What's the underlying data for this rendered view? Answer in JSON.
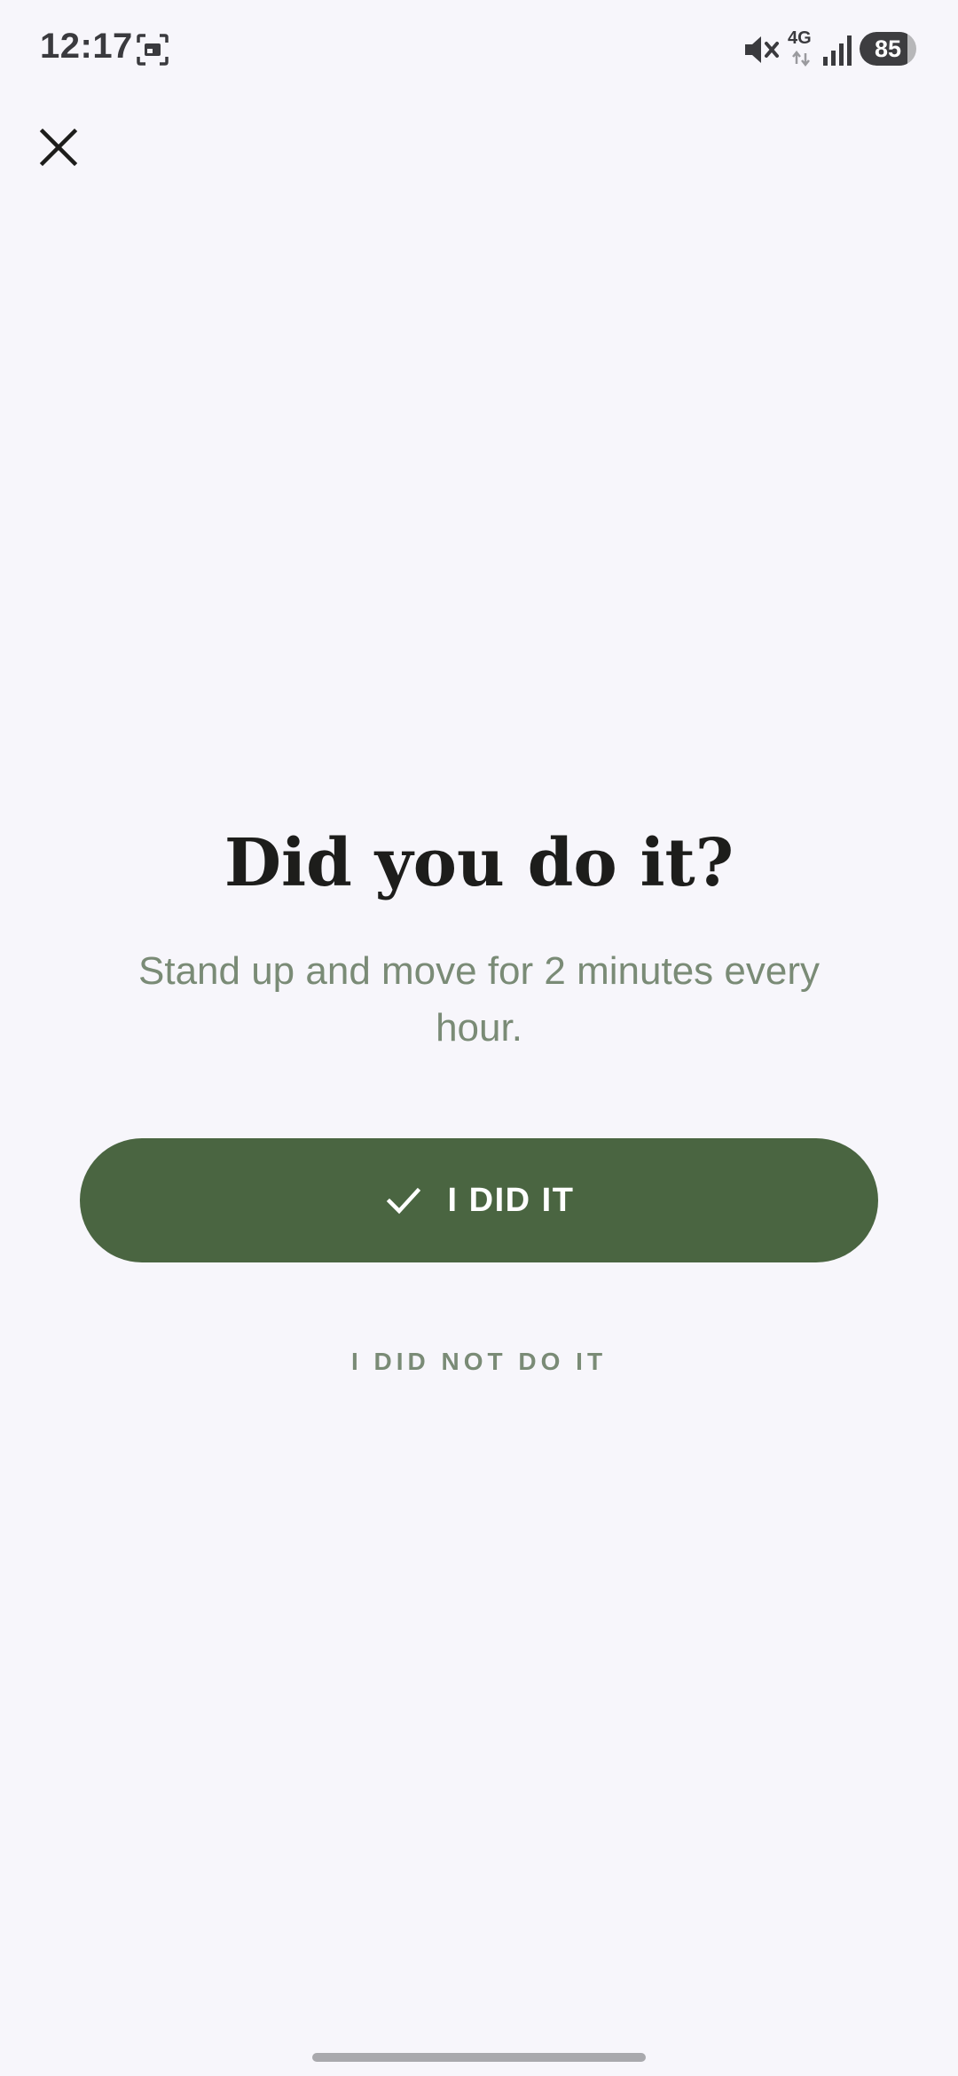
{
  "status_bar": {
    "time": "12:17",
    "network": "4G",
    "battery": 85,
    "battery_label": "85",
    "icons": [
      "screenshot-icon",
      "mute-icon",
      "network-4g-icon",
      "signal-icon",
      "battery-icon"
    ]
  },
  "header": {
    "close_icon": "close-icon"
  },
  "main": {
    "title": "Did you do it?",
    "subtitle": "Stand up and move for 2 minutes every hour.",
    "primary_button": {
      "icon": "check-icon",
      "label": "I DID IT"
    },
    "secondary_button": {
      "label": "I DID NOT DO IT"
    }
  },
  "colors": {
    "background": "#f7f6fb",
    "primary": "#4a6541",
    "muted_text": "#7a8b76",
    "title_text": "#1d1d1b"
  }
}
